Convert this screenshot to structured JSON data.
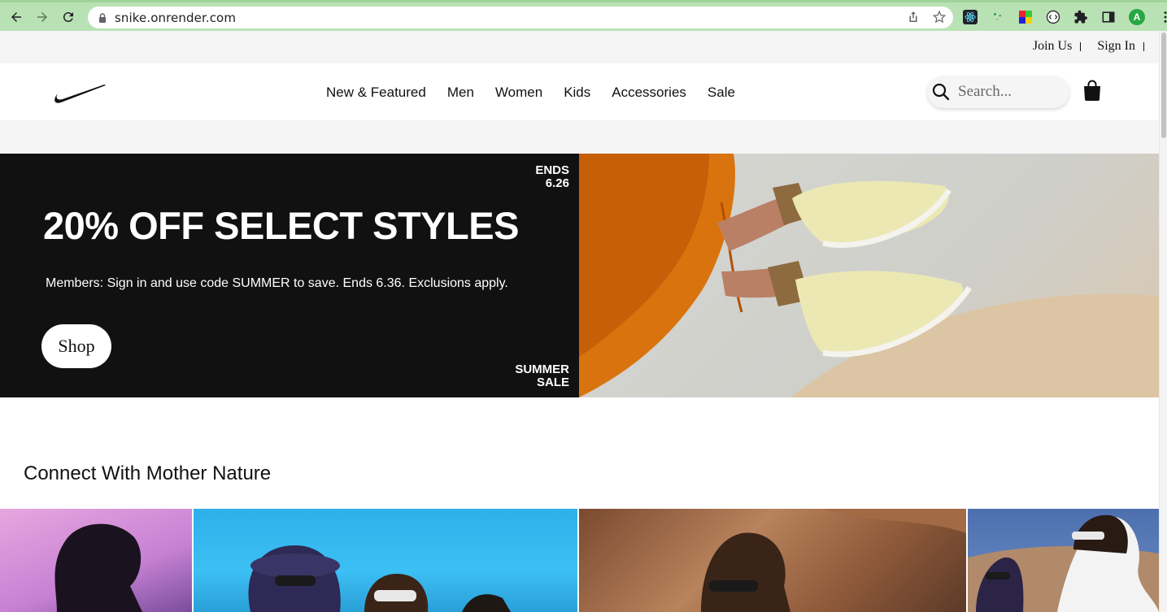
{
  "browser": {
    "url": "snike.onrender.com",
    "avatar_letter": "A"
  },
  "utility": {
    "join": "Join Us",
    "signin": "Sign In"
  },
  "nav": {
    "items": [
      "New & Featured",
      "Men",
      "Women",
      "Kids",
      "Accessories",
      "Sale"
    ]
  },
  "search": {
    "placeholder": "Search..."
  },
  "hero": {
    "title": "20% OFF SELECT STYLES",
    "subtitle": "Members: Sign in and use code SUMMER to save. Ends 6.36. Exclusions apply.",
    "ends_line1": "ENDS",
    "ends_line2": "6.26",
    "summer_line1": "SUMMER",
    "summer_line2": "SALE",
    "cta": "Shop"
  },
  "section": {
    "title": "Connect With Mother Nature"
  },
  "colors": {
    "chrome": "#b9e2b4",
    "hero_bg": "#111111",
    "accent_orange": "#d9730e"
  }
}
